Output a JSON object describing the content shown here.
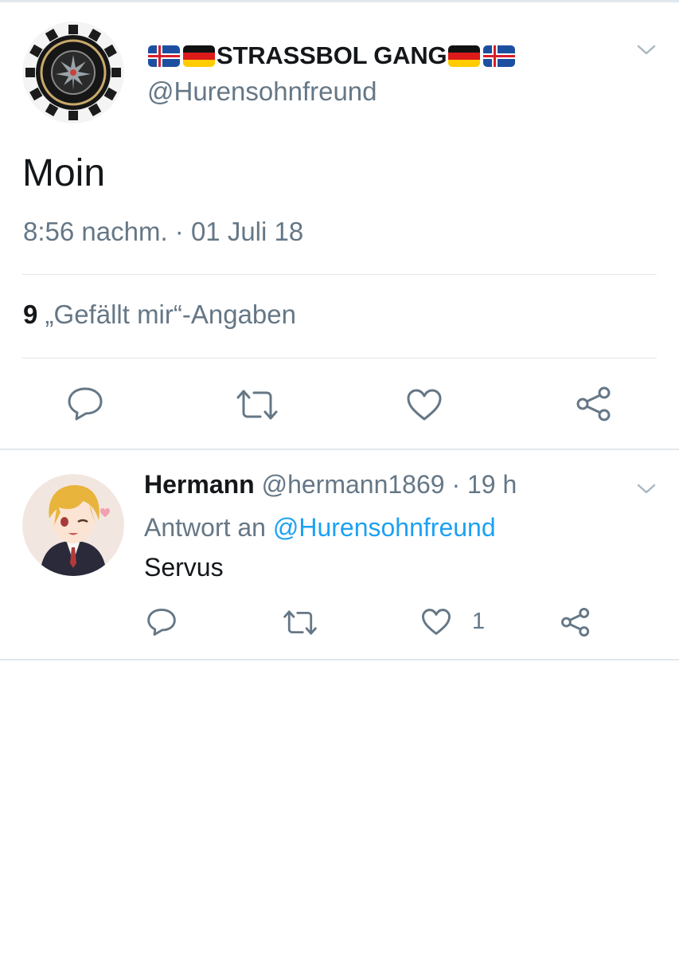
{
  "tweet": {
    "display_name": "STRASSBOL GANG",
    "handle": "@Hurensohnfreund",
    "text": "Moin",
    "timestamp": "8:56 nachm. · 01 Juli 18",
    "likes_count": "9",
    "likes_label": "„Gefällt mir“-Angaben",
    "flags": [
      "iceland-flag",
      "germany-flag"
    ]
  },
  "reply": {
    "name": "Hermann",
    "handle": "@hermann1869",
    "age": "· 19 h",
    "reply_prefix": "Antwort an",
    "reply_to": "@Hurensohnfreund",
    "text": "Servus",
    "like_count": "1"
  },
  "icons": [
    "reply-icon",
    "retweet-icon",
    "like-icon",
    "share-icon",
    "chevron-down-icon"
  ],
  "colors": {
    "text": "#14171a",
    "secondary": "#657786",
    "link": "#1da1f2",
    "border": "#e1e8ed"
  }
}
